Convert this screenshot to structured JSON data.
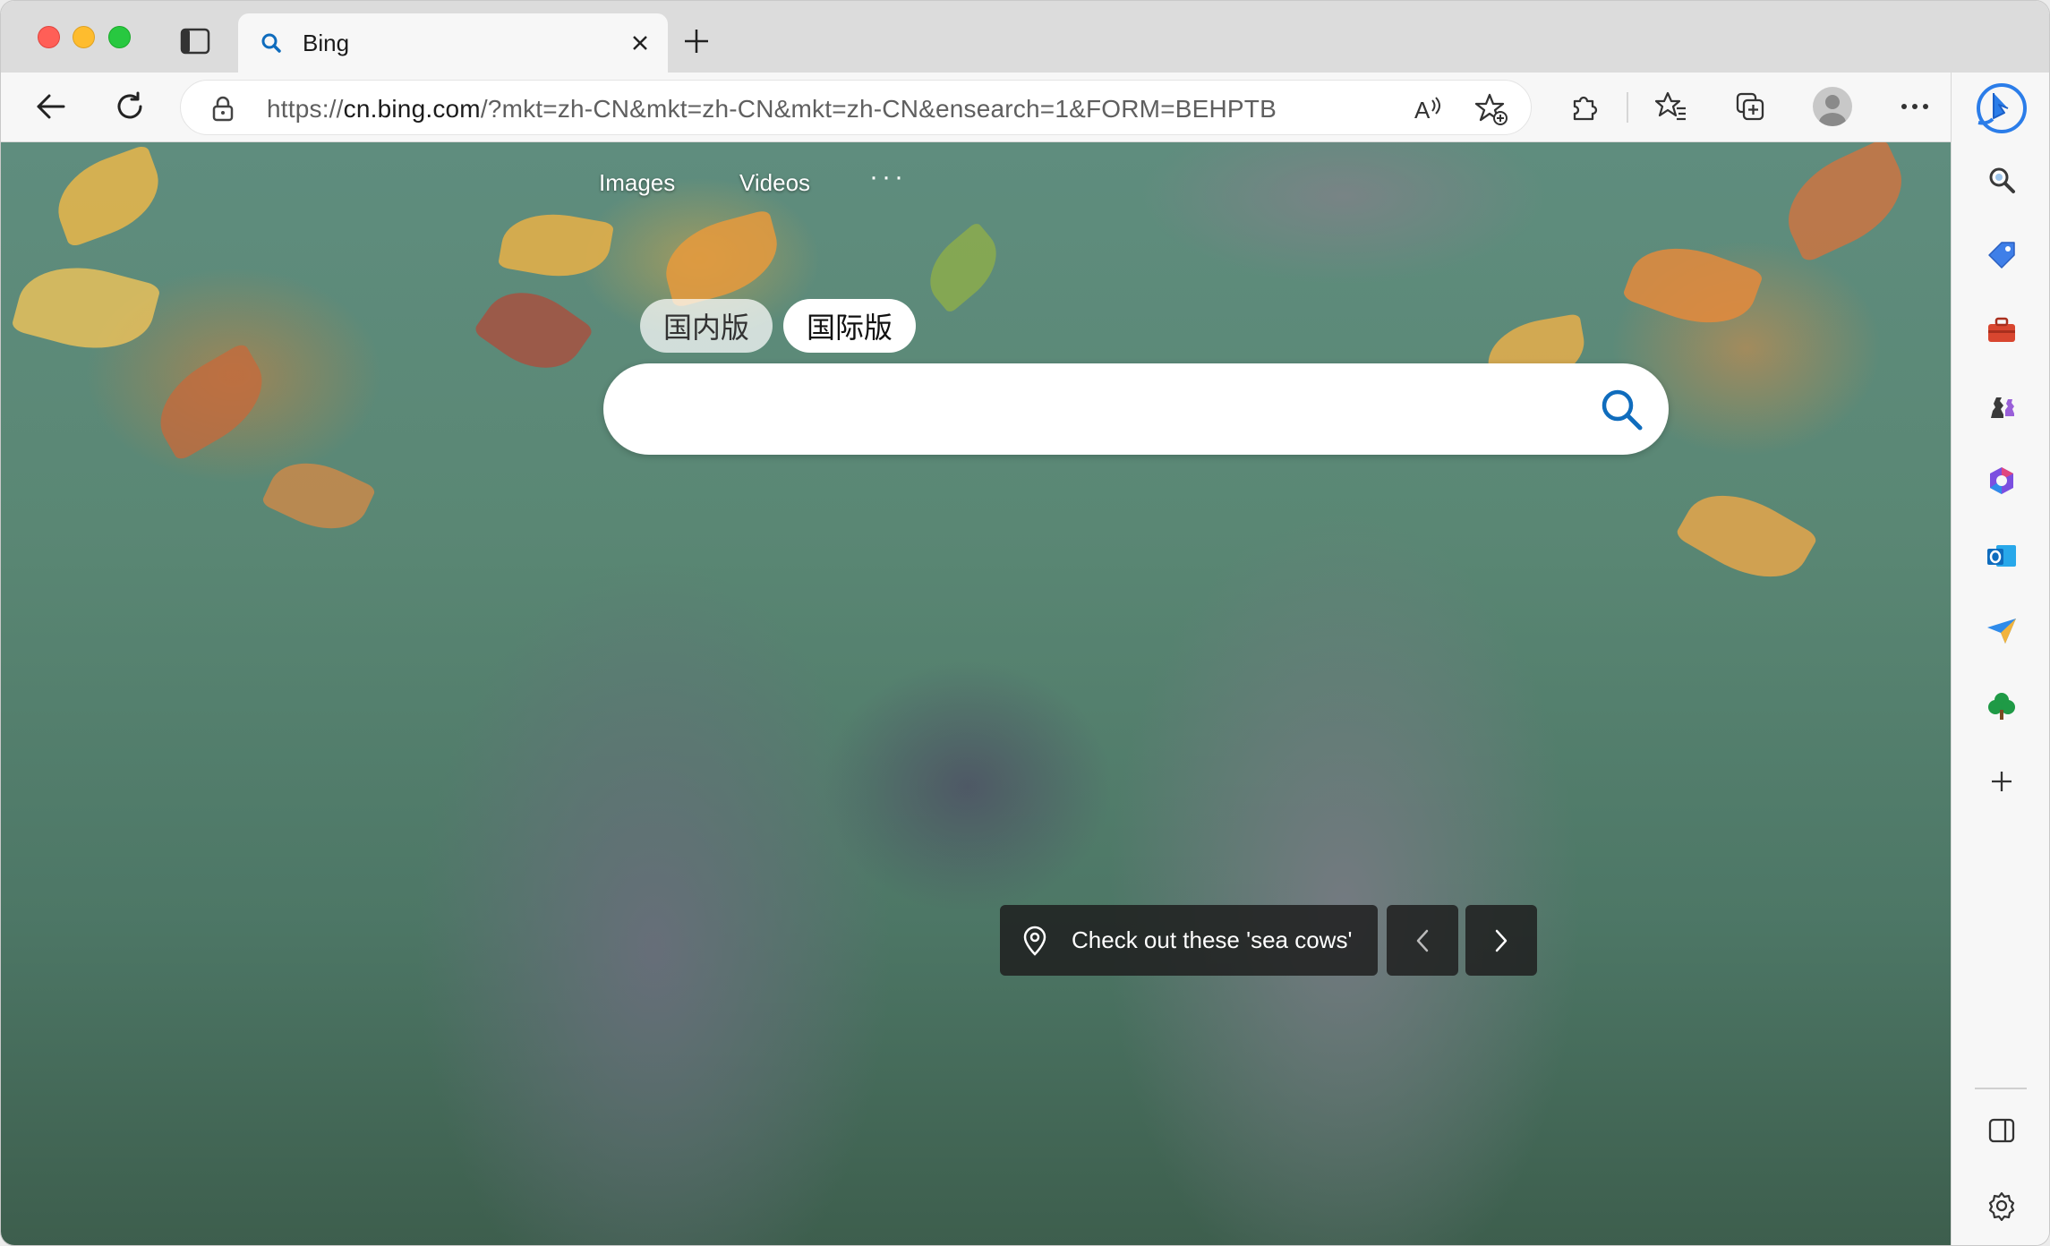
{
  "tab": {
    "title": "Bing"
  },
  "toolbar": {
    "url_host": "https://cn.bing.com/",
    "url_prefix": "https://",
    "url_domain": "cn.bing.com",
    "url_rest": "/?mkt=zh-CN&mkt=zh-CN&mkt=zh-CN&ensearch=1&FORM=BEHPTB"
  },
  "page": {
    "nav": {
      "images": "Images",
      "videos": "Videos",
      "more": "···"
    },
    "markets": {
      "domestic": "国内版",
      "international": "国际版"
    },
    "search": {
      "placeholder": ""
    },
    "caption": "Check out these 'sea cows'"
  },
  "sidebar": {
    "items": [
      "search-icon",
      "tag-icon",
      "toolbox-icon",
      "chess-icon",
      "office-icon",
      "outlook-icon",
      "send-icon",
      "tree-icon",
      "add-icon"
    ],
    "bottom": [
      "sidebar-toggle-icon",
      "settings-icon"
    ]
  },
  "colors": {
    "accent": "#0f6cbd",
    "red": "#ff5f57",
    "yellow": "#febc2e",
    "green": "#28c840"
  }
}
